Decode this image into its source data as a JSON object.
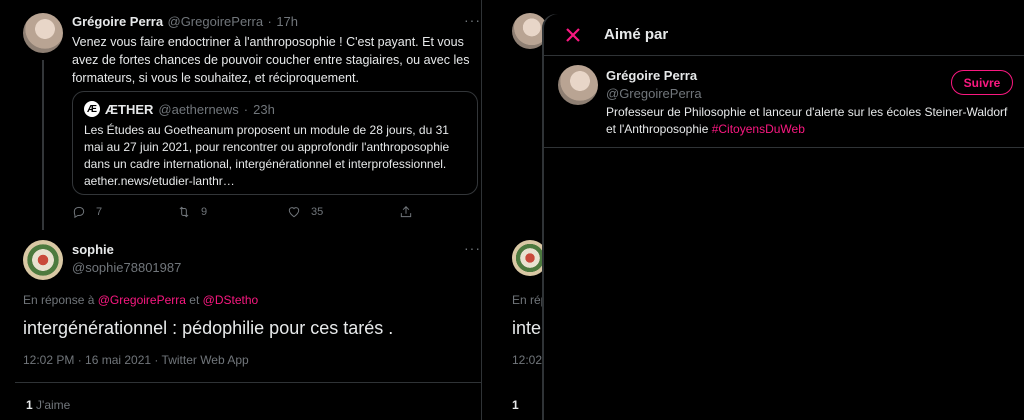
{
  "tweet": {
    "author_name": "Grégoire Perra",
    "author_handle": "@GregoirePerra",
    "sep": "·",
    "time": "17h",
    "text": "Venez vous faire endoctriner à l'anthroposophie ! C'est payant. Et vous avez de fortes chances de pouvoir coucher entre stagiaires, ou avec les formateurs, si vous le souhaitez, et réciproquement.",
    "more": "···",
    "quote": {
      "logo": "Æ",
      "name": "ÆTHER",
      "handle": "@aethernews",
      "time": "23h",
      "text": "Les Études au Goetheanum proposent un module de 28 jours, du 31 mai au 27 juin 2021, pour rencontrer ou approfondir l'anthroposophie dans un cadre international, intergénérationnel et interprofessionnel. aether.news/etudier-lanthr…"
    },
    "actions": {
      "replies": "7",
      "retweets": "9",
      "likes": "35"
    }
  },
  "reply": {
    "author_name": "sophie",
    "author_handle": "@sophie78801987",
    "reply_prefix": "En réponse à",
    "mention1": "@GregoirePerra",
    "and": "et",
    "mention2": "@DStetho",
    "text": "intergénérationnel : pédophilie pour ces tarés .",
    "timestamp": "12:02 PM · 16 mai 2021 · Twitter Web App",
    "likes_count": "1",
    "likes_label": "J'aime"
  },
  "background": {
    "reply_prefix_partial": "En répo",
    "text_partial": "inte",
    "timestamp_partial": "12:02",
    "likes_partial": "1"
  },
  "modal": {
    "title": "Aimé par",
    "user": {
      "name": "Grégoire Perra",
      "handle": "@GregoirePerra",
      "bio": "Professeur de Philosophie et lanceur d'alerte sur les écoles Steiner-Waldorf et l'Anthroposophie",
      "hashtag": "#CitoyensDuWeb",
      "follow_label": "Suivre"
    }
  },
  "colors": {
    "accent": "#f91880",
    "background": "#000000",
    "muted": "#71767b",
    "border": "#2f3336"
  }
}
